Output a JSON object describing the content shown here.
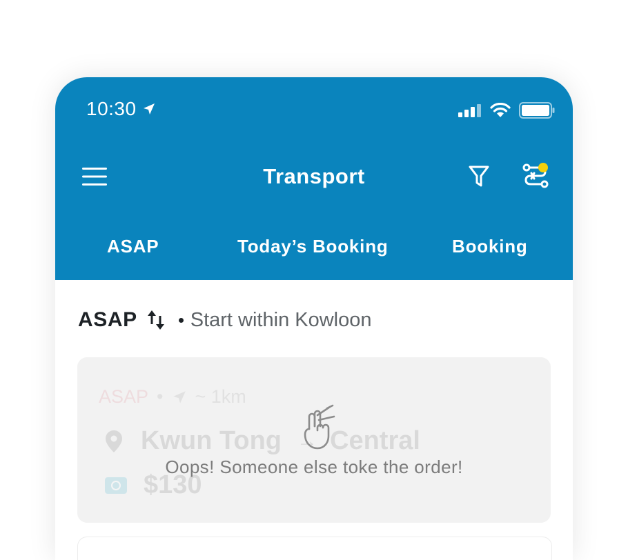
{
  "theme": {
    "accent": "#0a84bd",
    "notification_dot": "#f5d00a"
  },
  "status_bar": {
    "time": "10:30",
    "icons": [
      "location-arrow-icon",
      "cellular-signal-icon",
      "wifi-icon",
      "battery-icon"
    ]
  },
  "top_bar": {
    "title": "Transport",
    "icons": {
      "left": "menu-icon",
      "filter": "filter-icon",
      "routes": "route-settings-icon"
    }
  },
  "tabs": [
    {
      "label": "ASAP"
    },
    {
      "label": "Today’s Booking"
    },
    {
      "label": "Booking"
    }
  ],
  "sort": {
    "label": "ASAP",
    "icon": "sort-arrows-icon",
    "subtitle": "Start within Kowloon"
  },
  "order_card": {
    "tag": "ASAP",
    "distance": "~ 1km",
    "from": "Kwun Tong",
    "to": "Central",
    "price": "$130",
    "overlay_icon": "crossed-fingers-icon",
    "message": "Oops! Someone else toke the order!"
  }
}
